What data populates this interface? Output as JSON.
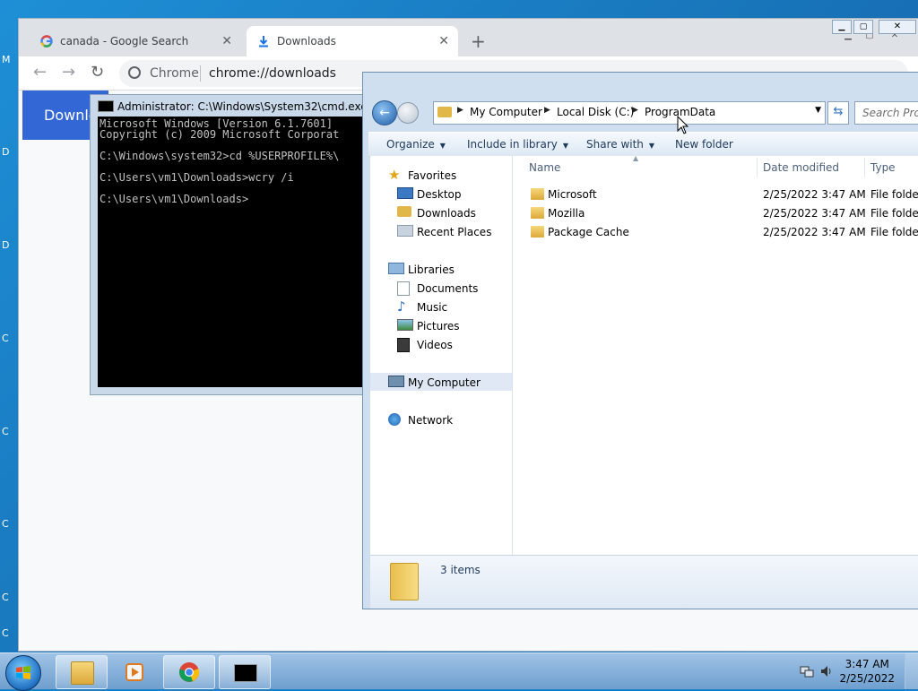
{
  "desktop": {
    "glyphs": [
      "M",
      "D",
      "D",
      "C",
      "C",
      "C",
      "C",
      "C"
    ]
  },
  "chrome": {
    "tabs": [
      {
        "label": "canada - Google Search",
        "active": false
      },
      {
        "label": "Downloads",
        "active": true
      }
    ],
    "new_tab": "+",
    "omnibox_site": "Chrome",
    "omnibox_url": "chrome://downloads",
    "page_banner": "Downlo"
  },
  "cmd": {
    "title": "Administrator: C:\\Windows\\System32\\cmd.exe",
    "lines": [
      "Microsoft Windows [Version 6.1.7601]",
      "Copyright (c) 2009 Microsoft Corporat",
      "",
      "C:\\Windows\\system32>cd %USERPROFILE%\\",
      "",
      "C:\\Users\\vm1\\Downloads>wcry /i",
      "",
      "C:\\Users\\vm1\\Downloads>"
    ]
  },
  "explorer": {
    "breadcrumb": [
      "My Computer",
      "Local Disk (C:)",
      "ProgramData"
    ],
    "search_placeholder": "Search Prog",
    "toolbar": {
      "organize": "Organize",
      "include_in_library": "Include in library",
      "share_with": "Share with",
      "new_folder": "New folder"
    },
    "nav": {
      "favorites": "Favorites",
      "favorites_items": [
        "Desktop",
        "Downloads",
        "Recent Places"
      ],
      "libraries": "Libraries",
      "libraries_items": [
        "Documents",
        "Music",
        "Pictures",
        "Videos"
      ],
      "computer": "My Computer",
      "network": "Network"
    },
    "columns": {
      "name": "Name",
      "date": "Date modified",
      "type": "Type"
    },
    "rows": [
      {
        "name": "Microsoft",
        "date": "2/25/2022 3:47 AM",
        "type": "File folder"
      },
      {
        "name": "Mozilla",
        "date": "2/25/2022 3:47 AM",
        "type": "File folder"
      },
      {
        "name": "Package Cache",
        "date": "2/25/2022 3:47 AM",
        "type": "File folder"
      }
    ],
    "status": "3 items"
  },
  "taskbar": {
    "apps": [
      "explorer-icon",
      "media-player-icon",
      "chrome-icon",
      "cmd-icon"
    ],
    "time": "3:47 AM",
    "date": "2/25/2022"
  },
  "colors": {
    "chrome_banner": "#3367d6",
    "cmd_background": "#000000",
    "desktop": "#1e8fd6"
  }
}
